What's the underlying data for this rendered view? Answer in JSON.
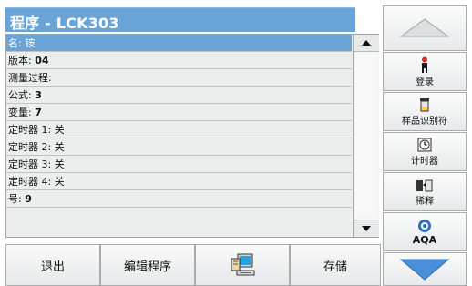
{
  "title": "程序 - LCK303",
  "list": {
    "rows": [
      {
        "key": "名:",
        "value": "铵",
        "selected": true
      },
      {
        "key": "版本:",
        "value": "04",
        "selected": false
      },
      {
        "key": "测量过程:",
        "value": "",
        "selected": false
      },
      {
        "key": "公式:",
        "value": "3",
        "selected": false
      },
      {
        "key": "变量:",
        "value": "7",
        "selected": false
      },
      {
        "key": "定时器 1:",
        "value": "关",
        "selected": false
      },
      {
        "key": "定时器 2:",
        "value": "关",
        "selected": false
      },
      {
        "key": "定时器 3:",
        "value": "关",
        "selected": false
      },
      {
        "key": "定时器 4:",
        "value": "关",
        "selected": false
      },
      {
        "key": "号:",
        "value": "9",
        "selected": false
      }
    ]
  },
  "bottom": {
    "exit_label": "退出",
    "edit_label": "编辑程序",
    "pc_icon": "computer-icon",
    "save_label": "存储"
  },
  "side": {
    "up_icon": "triangle-up-icon",
    "login_label": "登录",
    "sample_id_label": "样品识别符",
    "timer_label": "计时器",
    "dilution_label": "稀释",
    "aqa_label": "AQA",
    "down_icon": "chevron-down-icon"
  },
  "colors": {
    "title_bg": "#6aa4d6",
    "selected_row": "#6aa4d6",
    "nav_arrow": "#3f7fc8"
  }
}
